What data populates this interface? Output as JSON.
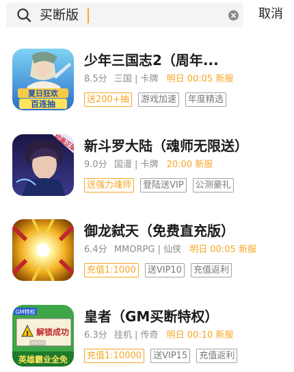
{
  "search": {
    "query": "买断版",
    "cancel_label": "取消"
  },
  "colors": {
    "accent": "#f5a623",
    "tag_border": "#a0a0a0",
    "meta_text": "#8c8c8c"
  },
  "games": [
    {
      "title": "少年三国志2（周年...",
      "rating": "8.5分",
      "genres": "三国 | 卡牌",
      "release": "明日 00:05 新服",
      "tags": [
        "送200+抽",
        "游戏加速",
        "年度精选"
      ],
      "icon_text": [
        "夏日狂欢",
        "百连抽"
      ]
    },
    {
      "title": "新斗罗大陆（魂师无限送）",
      "rating": "9.0分",
      "genres": "国漫 | 卡牌",
      "release": "20:00 新服",
      "tags": [
        "送强力魂师",
        "登陆送VIP",
        "公测豪礼"
      ],
      "icon_text": [
        "动画正版"
      ]
    },
    {
      "title": "御龙弑天（免费直充版）",
      "rating": "6.4分",
      "genres": "MMORPG | 仙侠",
      "release": "明日 00:05 新服",
      "tags": [
        "充值1:1000",
        "送VIP10",
        "充值返利"
      ],
      "icon_text": []
    },
    {
      "title": "皇者（GM买断特权）",
      "rating": "6.3分",
      "genres": "挂机 | 传奇",
      "release": "明日 00:10 新服",
      "tags": [
        "充值1:10000",
        "送VIP15",
        "充值返利"
      ],
      "icon_text": [
        "GM特权",
        "解锁成功",
        "英雄霸业全免"
      ]
    }
  ]
}
